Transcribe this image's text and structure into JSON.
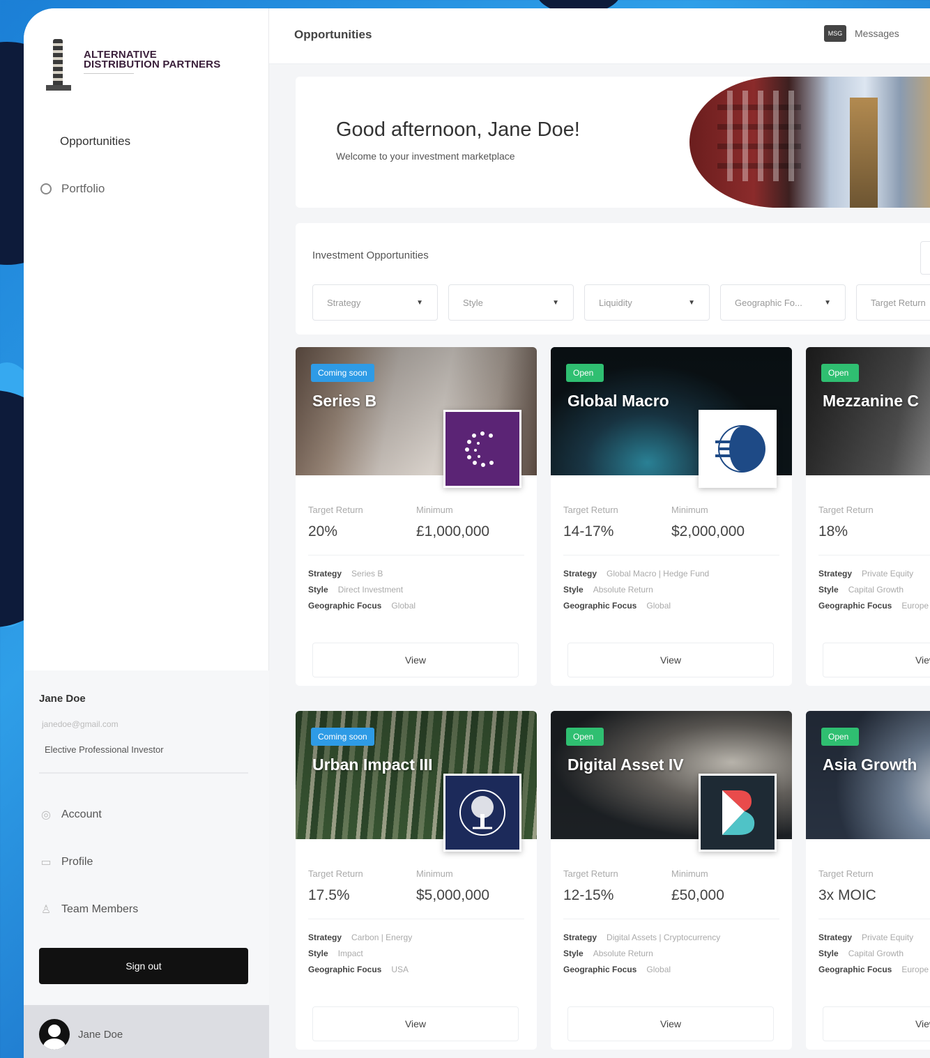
{
  "sidebar": {
    "brand_line1": "ALTERNATIVE",
    "brand_line2": "DISTRIBUTION PARTNERS",
    "nav": [
      {
        "label": "Opportunities",
        "icon": "grid-icon"
      },
      {
        "label": "Portfolio",
        "icon": "circle-icon"
      }
    ],
    "user": {
      "name": "Jane Doe",
      "email": "janedoe@gmail.com",
      "type": "Elective Professional Investor"
    },
    "sub_nav": [
      {
        "label": "Account",
        "icon": "account-icon"
      },
      {
        "label": "Profile",
        "icon": "profile-icon"
      },
      {
        "label": "Team Members",
        "icon": "team-icon"
      }
    ],
    "signout_label": "Sign out",
    "account_name": "Jane Doe"
  },
  "topbar": {
    "title": "Opportunities",
    "messages_label": "Messages",
    "messages_icon_text": "MSG"
  },
  "hero": {
    "greeting": "Good afternoon, Jane Doe!",
    "subtitle": "Welcome to your investment marketplace"
  },
  "filters": {
    "title": "Investment Opportunities",
    "items": [
      "Strategy",
      "Style",
      "Liquidity",
      "Geographic Fo...",
      "Target Return"
    ]
  },
  "labels": {
    "target_return": "Target Return",
    "minimum": "Minimum",
    "strategy": "Strategy",
    "style": "Style",
    "geo_focus": "Geographic Focus",
    "view": "View"
  },
  "cards": [
    {
      "badge": "Coming soon",
      "title": "Series B",
      "target": "20%",
      "minimum": "£1,000,000",
      "strategy": "Series B",
      "style": "Direct Investment",
      "geo": "Global"
    },
    {
      "badge": "Open",
      "title": "Global Macro",
      "target": "14-17%",
      "minimum": "$2,000,000",
      "strategy": "Global Macro | Hedge Fund",
      "style": "Absolute Return",
      "geo": "Global"
    },
    {
      "badge": "Open",
      "title": "Mezzanine C",
      "target": "18%",
      "minimum": "",
      "strategy": "Private Equity",
      "style": "Capital Growth",
      "geo": "Europe"
    },
    {
      "badge": "Coming soon",
      "title": "Urban Impact III",
      "target": "17.5%",
      "minimum": "$5,000,000",
      "strategy": "Carbon | Energy",
      "style": "Impact",
      "geo": "USA"
    },
    {
      "badge": "Open",
      "title": "Digital Asset IV",
      "target": "12-15%",
      "minimum": "£50,000",
      "strategy": "Digital Assets | Cryptocurrency",
      "style": "Absolute Return",
      "geo": "Global"
    },
    {
      "badge": "Open",
      "title": "Asia Growth",
      "target": "3x MOIC",
      "minimum": "",
      "strategy": "Private Equity",
      "style": "Capital Growth",
      "geo": "Europe"
    }
  ],
  "colors": {
    "badge_soon": "#2e9be6",
    "badge_open": "#2fbf71",
    "signout_bg": "#111111"
  }
}
